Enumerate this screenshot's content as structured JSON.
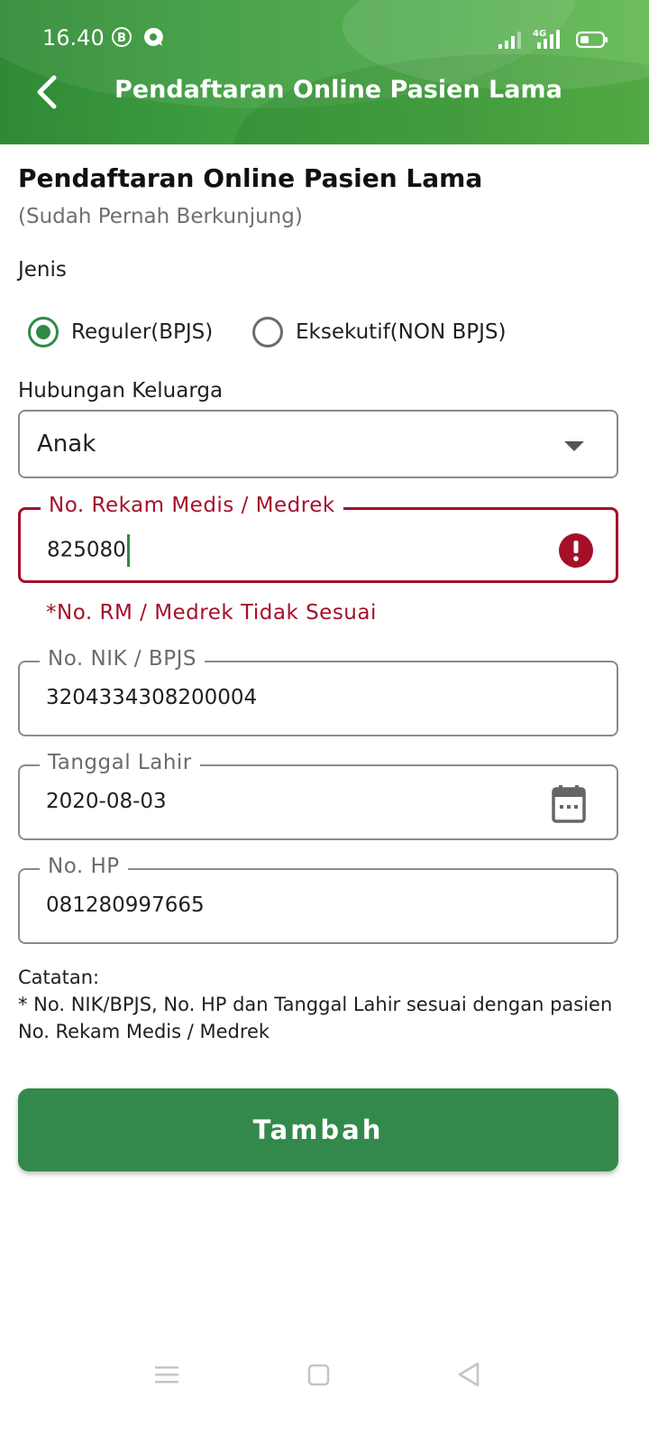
{
  "status_bar": {
    "time": "16.40",
    "icons": [
      "b-circle-icon",
      "chat-icon",
      "signal-icon",
      "network-4g-icon",
      "battery-icon"
    ]
  },
  "header": {
    "title": "Pendaftaran Online Pasien Lama",
    "back_icon": "chevron-left-icon"
  },
  "form": {
    "heading": "Pendaftaran Online Pasien Lama",
    "subheading": "(Sudah Pernah Berkunjung)",
    "jenis_label": "Jenis",
    "jenis_options": [
      {
        "label": "Reguler(BPJS)",
        "selected": true
      },
      {
        "label": "Eksekutif(NON BPJS)",
        "selected": false
      }
    ],
    "hubungan_label": "Hubungan Keluarga",
    "hubungan_value": "Anak",
    "rekam_medis": {
      "label": "No. Rekam Medis / Medrek",
      "value": "825080",
      "error": "*No. RM / Medrek Tidak Sesuai"
    },
    "nik": {
      "label": "No. NIK / BPJS",
      "value": "3204334308200004"
    },
    "tanggal_lahir": {
      "label": "Tanggal Lahir",
      "value": "2020-08-03"
    },
    "hp": {
      "label": "No. HP",
      "value": "081280997665"
    },
    "note_title": "Catatan:",
    "note_text": "* No. NIK/BPJS, No. HP dan Tanggal Lahir sesuai dengan pasien No. Rekam Medis / Medrek",
    "submit_label": "Tambah"
  },
  "colors": {
    "primary_green": "#33894b",
    "error_red": "#a4102a",
    "header_green": "#3d9d3f"
  },
  "nav_bar": {
    "icons": [
      "menu-icon",
      "home-square-icon",
      "back-triangle-icon"
    ]
  }
}
